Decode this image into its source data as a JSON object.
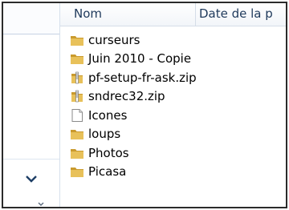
{
  "columns": {
    "name": "Nom",
    "date": "Date de la p"
  },
  "files": [
    {
      "label": "curseurs",
      "icon": "folder-icon"
    },
    {
      "label": "Juin 2010 - Copie",
      "icon": "folder-icon"
    },
    {
      "label": "pf-setup-fr-ask.zip",
      "icon": "zip-folder-icon"
    },
    {
      "label": "sndrec32.zip",
      "icon": "zip-folder-icon"
    },
    {
      "label": "Icones",
      "icon": "file-icon"
    },
    {
      "label": "loups",
      "icon": "folder-icon"
    },
    {
      "label": "Photos",
      "icon": "folder-icon"
    },
    {
      "label": "Picasa",
      "icon": "folder-icon"
    }
  ],
  "colors": {
    "folder": "#e8c15a",
    "folder_dark": "#c99a2e",
    "header_text": "#1e395b",
    "chevron": "#1f3f66"
  }
}
